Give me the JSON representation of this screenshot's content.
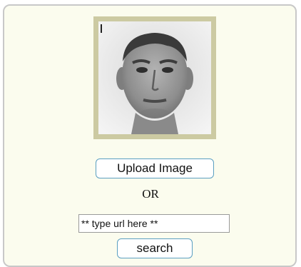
{
  "photo": {
    "subject": "face-photo",
    "frame_color": "#cccaa2"
  },
  "upload": {
    "label": "Upload Image"
  },
  "separator": {
    "label": "OR"
  },
  "url_input": {
    "value": "** type url here **"
  },
  "search": {
    "label": "search"
  },
  "colors": {
    "panel_background": "#fbfcee",
    "button_border": "#5b9fc1"
  }
}
